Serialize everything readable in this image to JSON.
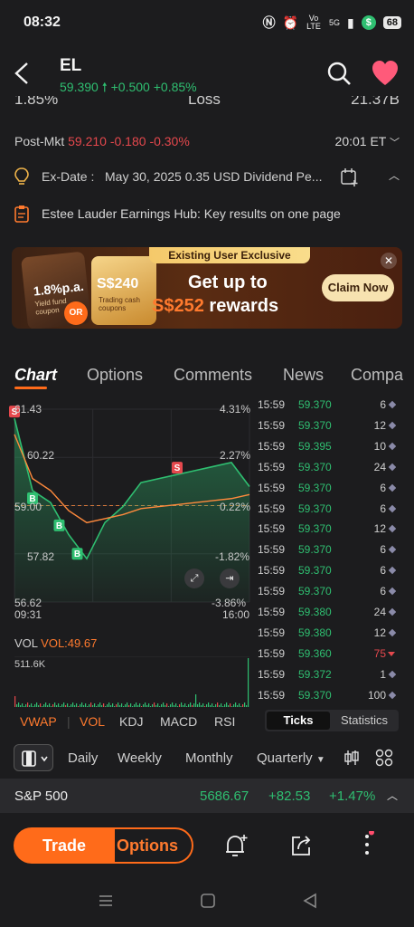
{
  "status_bar": {
    "time": "08:32",
    "network_label": "Vo LTE",
    "signal_label": "5G",
    "battery": "68"
  },
  "header": {
    "symbol": "EL",
    "price": "59.390",
    "change": "+0.500",
    "change_pct": "+0.85%",
    "change_color": "#2fbf71",
    "clipped_left": "1.85%",
    "clipped_mid": "Loss",
    "clipped_right": "21.37B"
  },
  "post_market": {
    "label": "Post-Mkt",
    "price": "59.210",
    "change": "-0.180",
    "change_pct": "-0.30%",
    "time": "20:01 ET"
  },
  "ex_date": {
    "label": "Ex-Date :",
    "text": "May 30, 2025 0.35 USD Dividend Pe..."
  },
  "earnings": {
    "text": "Estee Lauder Earnings Hub: Key results on one page"
  },
  "promo": {
    "badge": "Existing User Exclusive",
    "card1_rate": "1.8%p.a.",
    "card1_sub": "Yield fund coupon",
    "card2_amount": "S$240",
    "card2_sub": "Trading cash coupons",
    "or_label": "OR",
    "headline1": "Get up to",
    "headline_amount": "S$252",
    "headline_rest": "rewards",
    "claim_label": "Claim Now"
  },
  "tabs": [
    "Chart",
    "Options",
    "Comments",
    "News",
    "Compa"
  ],
  "chart": {
    "y_left": [
      "61.43",
      "60.22",
      "59.00",
      "57.82",
      "56.62"
    ],
    "y_right": [
      "4.31%",
      "2.27%",
      "0.22%",
      "-1.82%",
      "-3.86%"
    ],
    "time_start": "09:31",
    "time_end": "16:00",
    "accent_line": "#ff8a3d",
    "price_line": "#2fbf71"
  },
  "chart_data": {
    "type": "line",
    "title": "",
    "xlabel": "",
    "ylabel": "",
    "x": [
      "09:31",
      "10:00",
      "10:30",
      "11:00",
      "11:30",
      "12:00",
      "12:30",
      "13:00",
      "13:30",
      "14:00",
      "14:30",
      "15:00",
      "15:30",
      "16:00"
    ],
    "series": [
      {
        "values": [
          61.2,
          59.4,
          59.1,
          58.3,
          57.7,
          58.6,
          59.0,
          59.6,
          59.7,
          59.8,
          59.9,
          60.0,
          60.1,
          59.5
        ]
      },
      {
        "values": [
          60.8,
          59.7,
          59.4,
          58.9,
          58.6,
          58.7,
          58.8,
          58.95,
          59.0,
          59.05,
          59.1,
          59.15,
          59.2,
          59.3
        ]
      }
    ],
    "ylim": [
      56.62,
      61.43
    ],
    "markers": [
      {
        "label": "S",
        "x": "09:31"
      },
      {
        "label": "B",
        "x": "10:00"
      },
      {
        "label": "B",
        "x": "10:45"
      },
      {
        "label": "B",
        "x": "11:15"
      },
      {
        "label": "S",
        "x": "14:00"
      }
    ],
    "grid": true
  },
  "ticks": [
    {
      "time": "15:59",
      "price": "59.370",
      "vol": "6",
      "color": "#2fbf71"
    },
    {
      "time": "15:59",
      "price": "59.370",
      "vol": "12",
      "color": "#2fbf71"
    },
    {
      "time": "15:59",
      "price": "59.395",
      "vol": "10",
      "color": "#2fbf71"
    },
    {
      "time": "15:59",
      "price": "59.370",
      "vol": "24",
      "color": "#2fbf71"
    },
    {
      "time": "15:59",
      "price": "59.370",
      "vol": "6",
      "color": "#2fbf71"
    },
    {
      "time": "15:59",
      "price": "59.370",
      "vol": "6",
      "color": "#2fbf71"
    },
    {
      "time": "15:59",
      "price": "59.370",
      "vol": "12",
      "color": "#2fbf71"
    },
    {
      "time": "15:59",
      "price": "59.370",
      "vol": "6",
      "color": "#2fbf71"
    },
    {
      "time": "15:59",
      "price": "59.370",
      "vol": "6",
      "color": "#2fbf71"
    },
    {
      "time": "15:59",
      "price": "59.370",
      "vol": "6",
      "color": "#2fbf71"
    },
    {
      "time": "15:59",
      "price": "59.380",
      "vol": "24",
      "color": "#2fbf71"
    },
    {
      "time": "15:59",
      "price": "59.380",
      "vol": "12",
      "color": "#2fbf71"
    },
    {
      "time": "15:59",
      "price": "59.360",
      "vol": "75",
      "color": "#2fbf71",
      "down": true
    },
    {
      "time": "15:59",
      "price": "59.372",
      "vol": "1",
      "color": "#2fbf71"
    },
    {
      "time": "15:59",
      "price": "59.370",
      "vol": "100",
      "color": "#2fbf71"
    }
  ],
  "volume": {
    "label": "VOL",
    "value_label": "VOL:49.67",
    "max_label": "511.6K"
  },
  "indicators": [
    "VWAP",
    "VOL",
    "KDJ",
    "MACD",
    "RSI"
  ],
  "ticks_toggle": {
    "ticks": "Ticks",
    "statistics": "Statistics"
  },
  "periods": [
    "Daily",
    "Weekly",
    "Monthly",
    "Quarterly"
  ],
  "index_bar": {
    "name": "S&P 500",
    "value": "5686.67",
    "change": "+82.53",
    "change_pct": "+1.47%"
  },
  "actions": {
    "trade": "Trade",
    "options": "Options"
  }
}
